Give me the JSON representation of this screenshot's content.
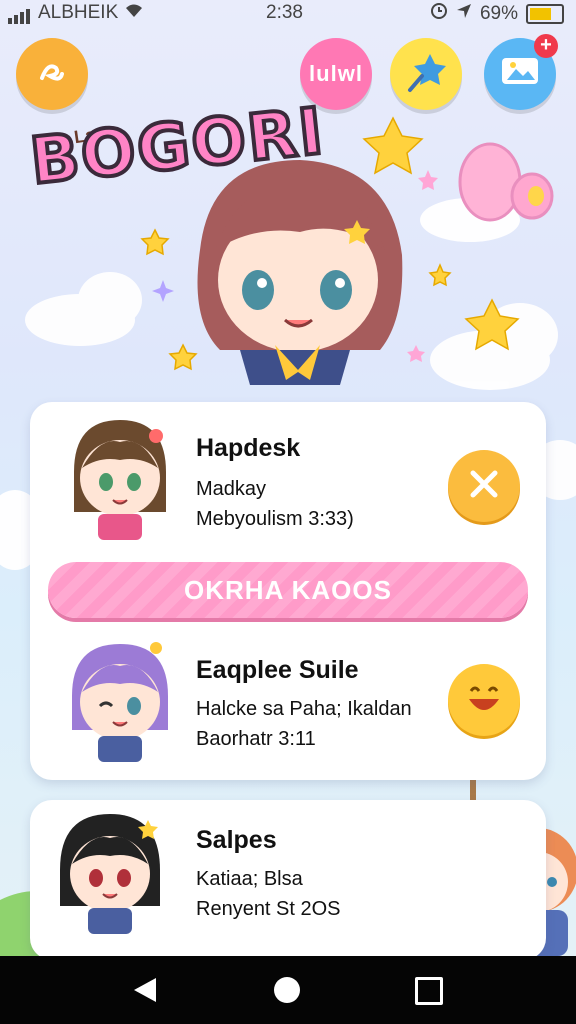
{
  "status_bar": {
    "carrier": "ALBHEIK",
    "time": "2:38",
    "battery": "69%",
    "battery_level": 0.69
  },
  "top_buttons": {
    "pink_label": "lulwl"
  },
  "logo": {
    "small": "Lams",
    "main_part1": "B",
    "main_part2": "ᴉ",
    "main_part3": "OGORI",
    "main_full": "BOGORI"
  },
  "list": [
    {
      "title": "Hapdesk",
      "line1": "Madkay",
      "line2": "Mebyoulism 3:33)"
    },
    {
      "title": "Eaqplee Suile",
      "line1": "Halcke sa Paha; Ikaldan",
      "line2": "Baorhatr 3:11"
    },
    {
      "title": "Salpes",
      "line1": "Katiaa; Blsa",
      "line2": "Renyent St 2OS"
    }
  ],
  "cta": {
    "label": "OKRHA KAOOS"
  },
  "colors": {
    "accent": "#ff84c6",
    "orange": "#f9b13a",
    "yellow": "#ffe24d",
    "blue": "#5ab7f4"
  },
  "icons": {
    "btn1": "doodle-icon",
    "btn3": "star-wand-icon",
    "btn4": "gallery-icon",
    "row1_action": "close-icon",
    "row2_action": "smile-emoji-icon"
  }
}
